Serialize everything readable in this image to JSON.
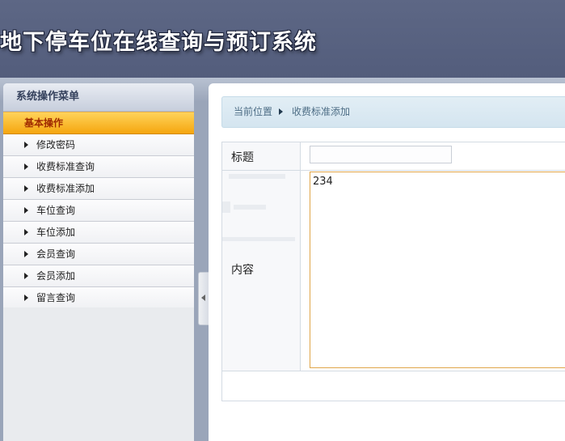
{
  "header": {
    "title": "地下停车位在线查询与预订系统"
  },
  "sidebar": {
    "heading": "系统操作菜单",
    "section": "基本操作",
    "items": [
      {
        "label": "修改密码"
      },
      {
        "label": "收费标准查询"
      },
      {
        "label": "收费标准添加"
      },
      {
        "label": "车位查询"
      },
      {
        "label": "车位添加"
      },
      {
        "label": "会员查询"
      },
      {
        "label": "会员添加"
      },
      {
        "label": "留言查询"
      }
    ]
  },
  "breadcrumb": {
    "current_label": "当前位置",
    "page": "收费标准添加"
  },
  "form": {
    "title_label": "标题",
    "title_value": "",
    "content_label": "内容",
    "content_value": "234"
  },
  "colors": {
    "header_bg": "#5d6785",
    "section_bg": "#f5a60f",
    "section_text": "#a02a00",
    "breadcrumb_bg": "#d4e5f0",
    "textarea_border": "#e0a64a"
  }
}
